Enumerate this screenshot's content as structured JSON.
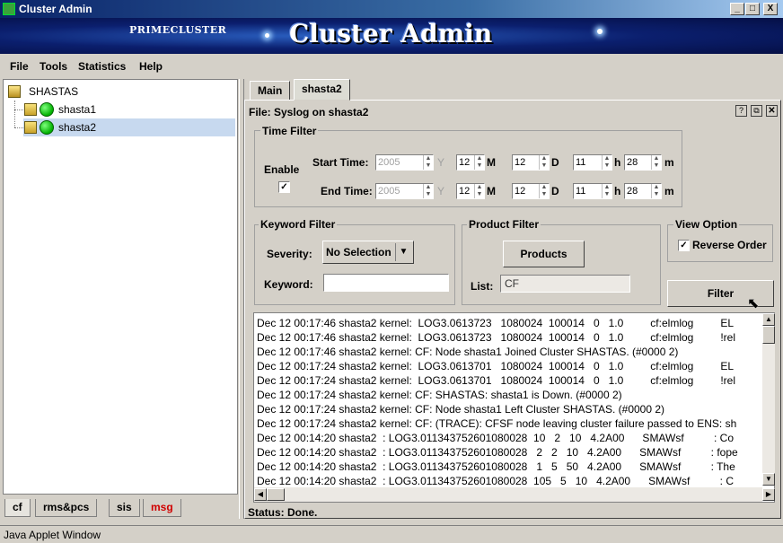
{
  "window": {
    "title": "Cluster Admin",
    "controls": {
      "minimize": "_",
      "maximize": "□",
      "close": "X"
    }
  },
  "banner": {
    "brand": "PRIMECLUSTER",
    "headline": "Cluster Admin"
  },
  "menu": [
    "File",
    "Tools",
    "Statistics",
    "Help"
  ],
  "tree": {
    "root": "SHASTAS",
    "nodes": [
      {
        "label": "shasta1",
        "status_color": "#00c000"
      },
      {
        "label": "shasta2",
        "status_color": "#00c000",
        "selected": true
      }
    ]
  },
  "left_tabs": [
    "cf",
    "rms&pcs",
    "sis",
    "msg"
  ],
  "tabs": [
    "Main",
    "shasta2"
  ],
  "panel": {
    "file_label": "File: Syslog on shasta2",
    "time_filter": {
      "title": "Time Filter",
      "enable_label": "Enable",
      "enable_checked": "✓",
      "start_label": "Start Time:",
      "end_label": "End Time:",
      "start": {
        "year": "2005",
        "month": "12",
        "day": "12",
        "hour": "11",
        "minute": "28"
      },
      "end": {
        "year": "2005",
        "month": "12",
        "day": "12",
        "hour": "11",
        "minute": "28"
      },
      "units": {
        "y": "Y",
        "m": "M",
        "d": "D",
        "h": "h",
        "min": "m"
      }
    },
    "keyword_filter": {
      "title": "Keyword Filter",
      "severity_label": "Severity:",
      "severity_value": "No Selection",
      "keyword_label": "Keyword:",
      "keyword_value": ""
    },
    "product_filter": {
      "title": "Product Filter",
      "button": "Products",
      "list_label": "List:",
      "list_value": "CF"
    },
    "view_option": {
      "title": "View Option",
      "reverse_label": "Reverse Order",
      "reverse_checked": "✓"
    },
    "filter_button": "Filter",
    "status": "Status: Done."
  },
  "log_lines": [
    "Dec 12 00:17:46 shasta2 kernel:  LOG3.0613723   1080024  100014   0   1.0         cf:elmlog         EL",
    "Dec 12 00:17:46 shasta2 kernel:  LOG3.0613723   1080024  100014   0   1.0         cf:elmlog         !rel",
    "Dec 12 00:17:46 shasta2 kernel: CF: Node shasta1 Joined Cluster SHASTAS. (#0000 2)",
    "Dec 12 00:17:24 shasta2 kernel:  LOG3.0613701   1080024  100014   0   1.0         cf:elmlog         EL",
    "Dec 12 00:17:24 shasta2 kernel:  LOG3.0613701   1080024  100014   0   1.0         cf:elmlog         !rel",
    "Dec 12 00:17:24 shasta2 kernel: CF: SHASTAS: shasta1 is Down. (#0000 2)",
    "Dec 12 00:17:24 shasta2 kernel: CF: Node shasta1 Left Cluster SHASTAS. (#0000 2)",
    "Dec 12 00:17:24 shasta2 kernel: CF: (TRACE): CFSF node leaving cluster failure passed to ENS: sh",
    "Dec 12 00:14:20 shasta2  : LOG3.011343752601080028  10   2   10   4.2A00      SMAWsf          : Co",
    "Dec 12 00:14:20 shasta2  : LOG3.011343752601080028   2   2   10   4.2A00      SMAWsf          : fope",
    "Dec 12 00:14:20 shasta2  : LOG3.011343752601080028   1   5   50   4.2A00      SMAWsf          : The",
    "Dec 12 00:14:20 shasta2  : LOG3.011343752601080028  105   5   10   4.2A00      SMAWsf          : C"
  ],
  "applet_status": "Java Applet Window",
  "colors": {
    "accent_red": "#d00000",
    "selection": "#c7d9ef",
    "title_blue": "#0a246a"
  }
}
